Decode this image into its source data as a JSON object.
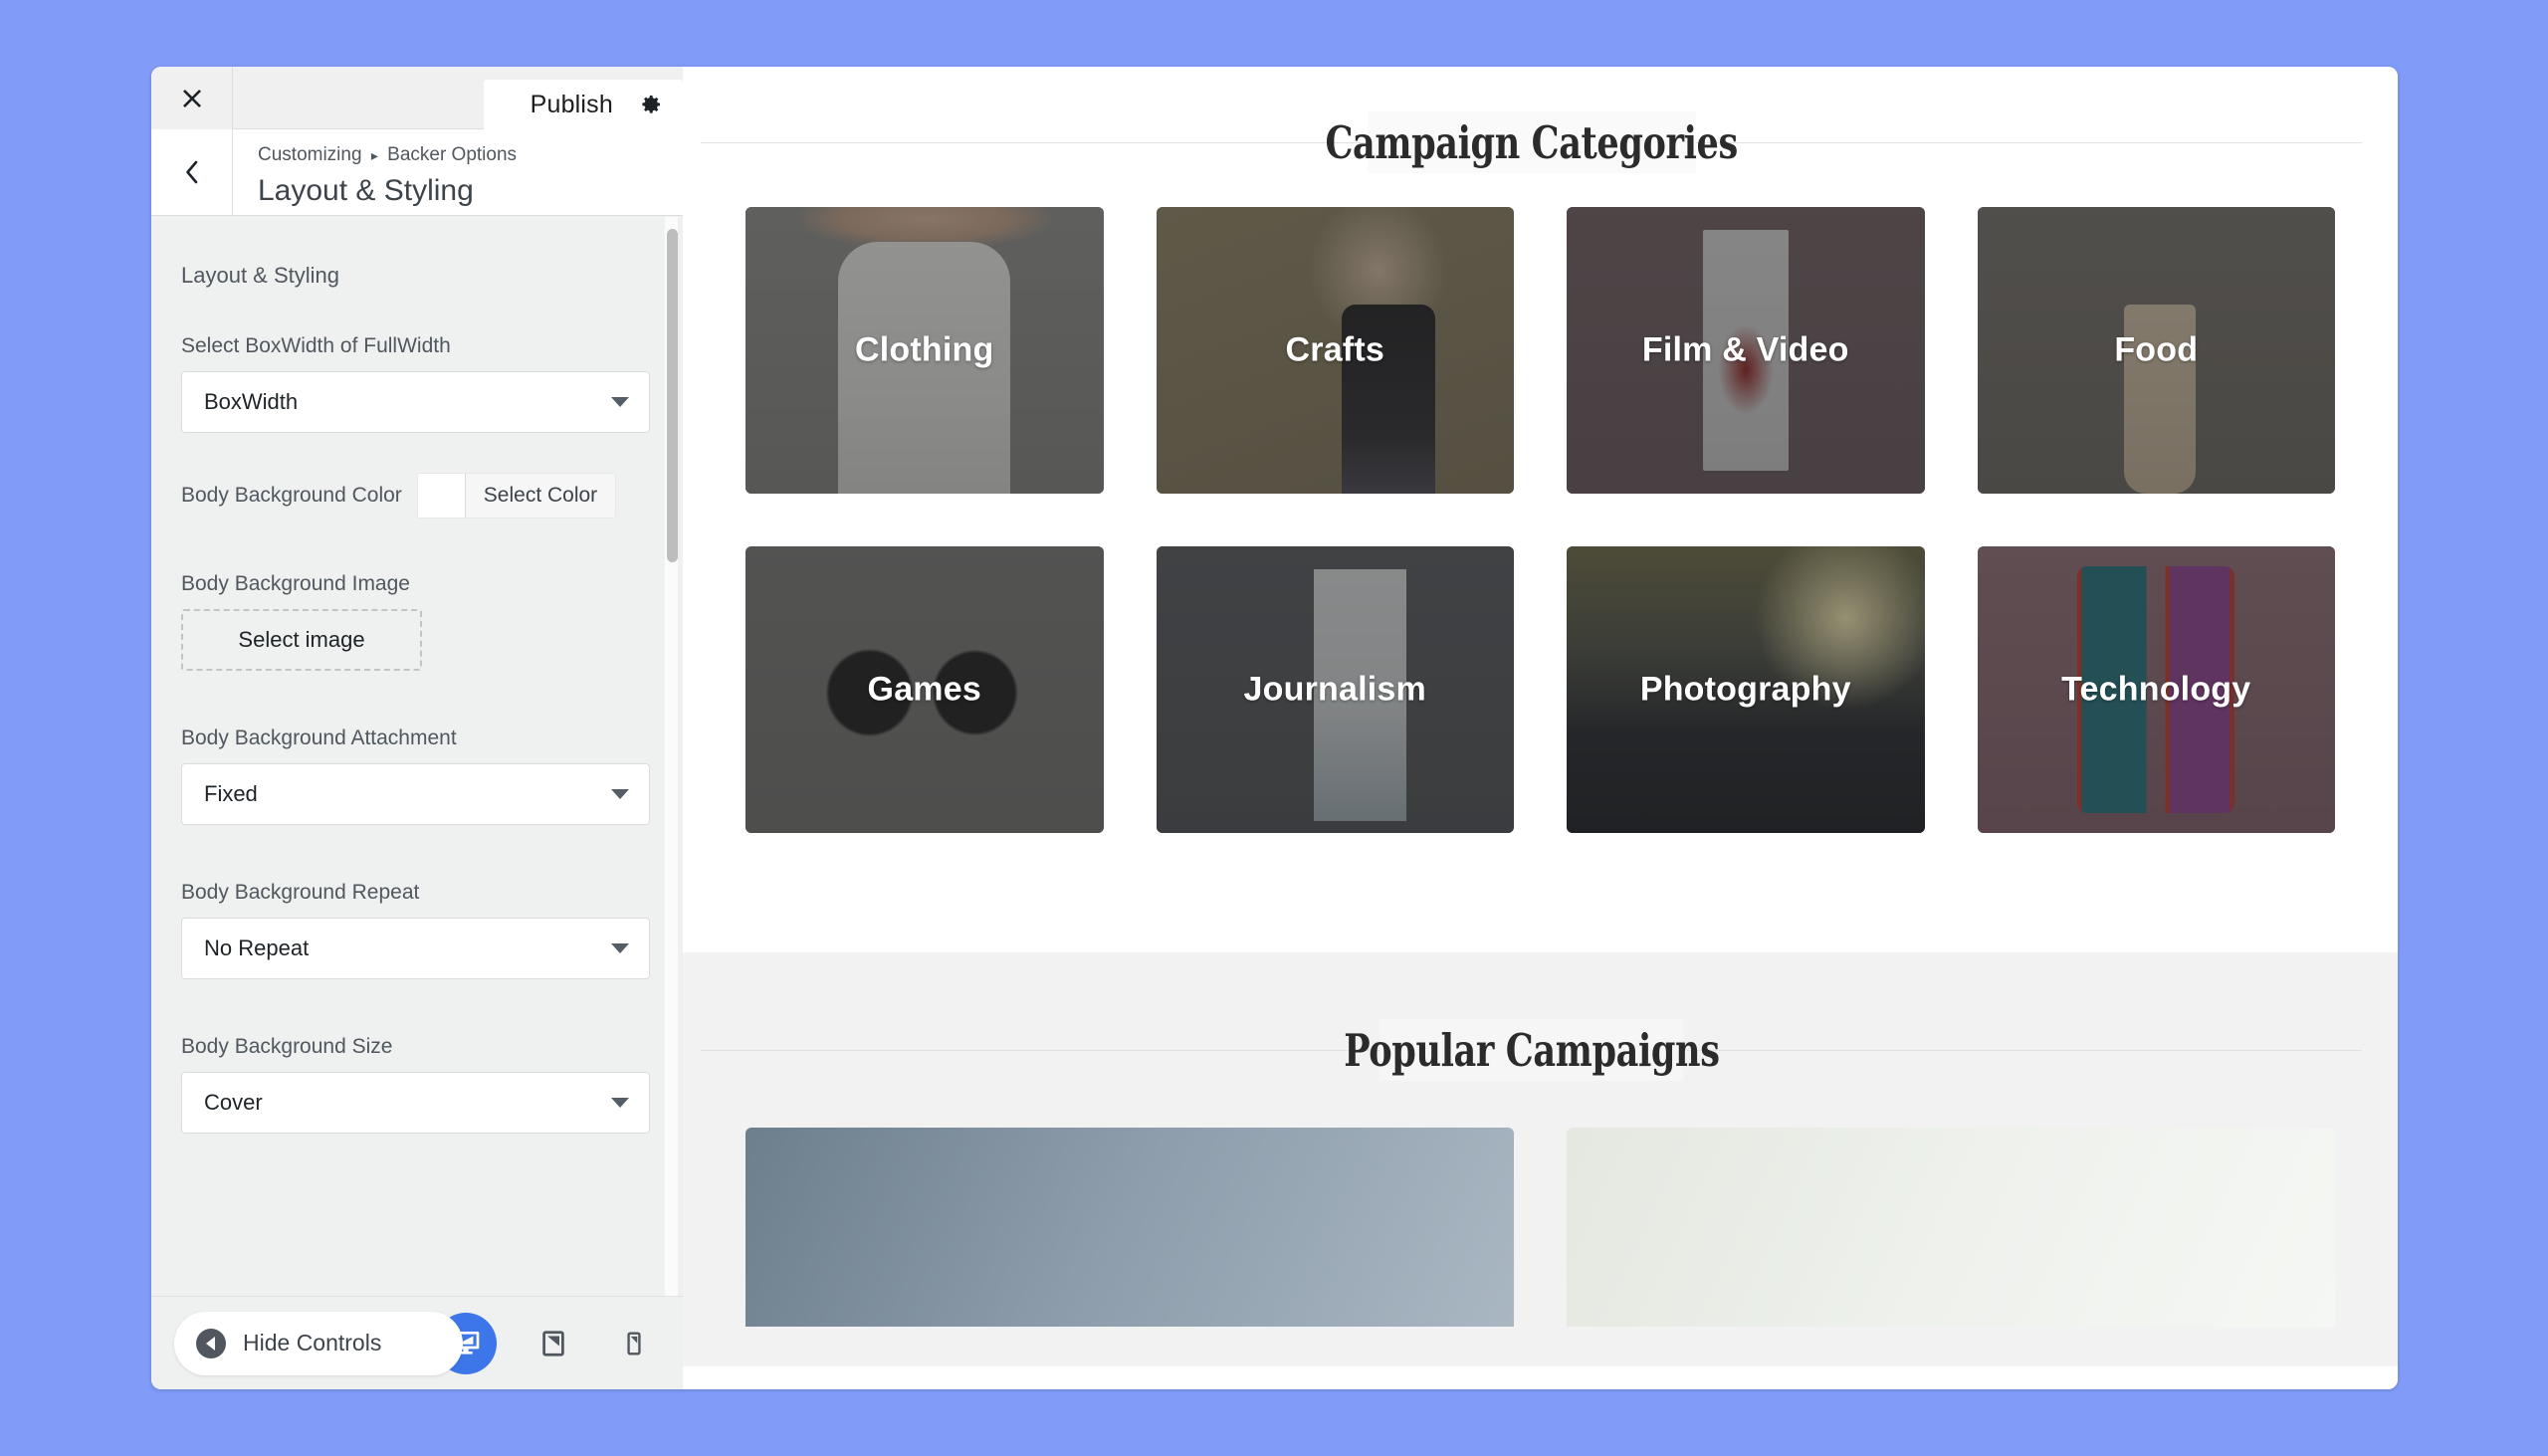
{
  "theme": {
    "page_background": "#819bf8",
    "accent_blue": "#3c76e8",
    "panel_background": "#eff1f0",
    "preview_background": "#ffffff",
    "grey_section": "#f2f2f2"
  },
  "customizer": {
    "close_icon": "close-icon",
    "publish_label": "Publish",
    "gear_icon": "gear-icon",
    "back_icon": "chevron-left-icon",
    "breadcrumb_root": "Customizing",
    "breadcrumb_separator": "▸",
    "breadcrumb_parent": "Backer Options",
    "section_title": "Layout & Styling",
    "panel_heading": "Layout & Styling",
    "controls": [
      {
        "name": "boxwidth",
        "label": "Select BoxWidth of FullWidth",
        "type": "select",
        "value": "BoxWidth"
      },
      {
        "name": "body-background-color",
        "label": "Body Background Color",
        "type": "color",
        "button_label": "Select Color",
        "swatch": "#ffffff"
      },
      {
        "name": "body-background-image",
        "label": "Body Background Image",
        "type": "image",
        "button_label": "Select image"
      },
      {
        "name": "body-background-attachment",
        "label": "Body Background Attachment",
        "type": "select",
        "value": "Fixed"
      },
      {
        "name": "body-background-repeat",
        "label": "Body Background Repeat",
        "type": "select",
        "value": "No Repeat"
      },
      {
        "name": "body-background-size",
        "label": "Body Background Size",
        "type": "select",
        "value": "Cover"
      }
    ],
    "footer": {
      "hide_controls_label": "Hide Controls",
      "hide_controls_icon": "caret-left-circle-icon",
      "devices": [
        {
          "name": "desktop",
          "icon": "desktop-icon",
          "active": true
        },
        {
          "name": "tablet",
          "icon": "tablet-icon",
          "active": false
        },
        {
          "name": "mobile",
          "icon": "mobile-icon",
          "active": false
        }
      ]
    }
  },
  "preview": {
    "categories_section": {
      "heading": "Campaign Categories",
      "cards": [
        {
          "title": "Clothing",
          "art": "art-clothing"
        },
        {
          "title": "Crafts",
          "art": "art-crafts"
        },
        {
          "title": "Film & Video",
          "art": "art-film"
        },
        {
          "title": "Food",
          "art": "art-food"
        },
        {
          "title": "Games",
          "art": "art-games"
        },
        {
          "title": "Journalism",
          "art": "art-journalism"
        },
        {
          "title": "Photography",
          "art": "art-photography"
        },
        {
          "title": "Technology",
          "art": "art-technology"
        }
      ]
    },
    "campaigns_section": {
      "heading": "Popular Campaigns",
      "cards": [
        {
          "art": "art-camp1"
        },
        {
          "art": "art-camp2"
        }
      ]
    }
  }
}
